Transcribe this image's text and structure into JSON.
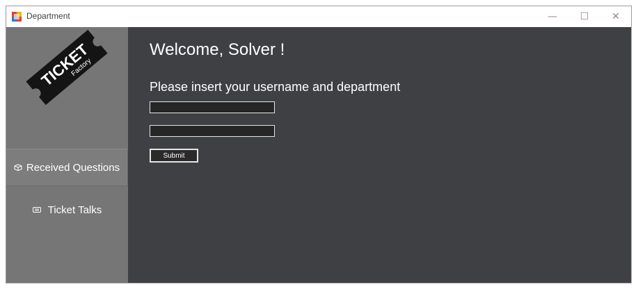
{
  "window": {
    "title": "Department",
    "app_icon": "winforms-app-icon",
    "controls": {
      "minimize": "—",
      "maximize": "☐",
      "close": "✕"
    }
  },
  "sidebar": {
    "logo": {
      "icon": "ticket-factory-logo",
      "line1": "TICKET",
      "line2": "Factory"
    },
    "items": [
      {
        "label": "Received Questions",
        "icon": "box-icon"
      },
      {
        "label": "Ticket Talks",
        "icon": "chat-icon"
      }
    ]
  },
  "main": {
    "welcome": "Welcome, Solver !",
    "instruction": "Please insert your username and department",
    "username": {
      "value": "",
      "placeholder": ""
    },
    "department": {
      "value": "",
      "placeholder": ""
    },
    "submit_label": "Submit"
  },
  "colors": {
    "sidebar_bg": "#767676",
    "main_bg": "#3e4044",
    "field_bg": "#262626",
    "text": "#ffffff"
  }
}
